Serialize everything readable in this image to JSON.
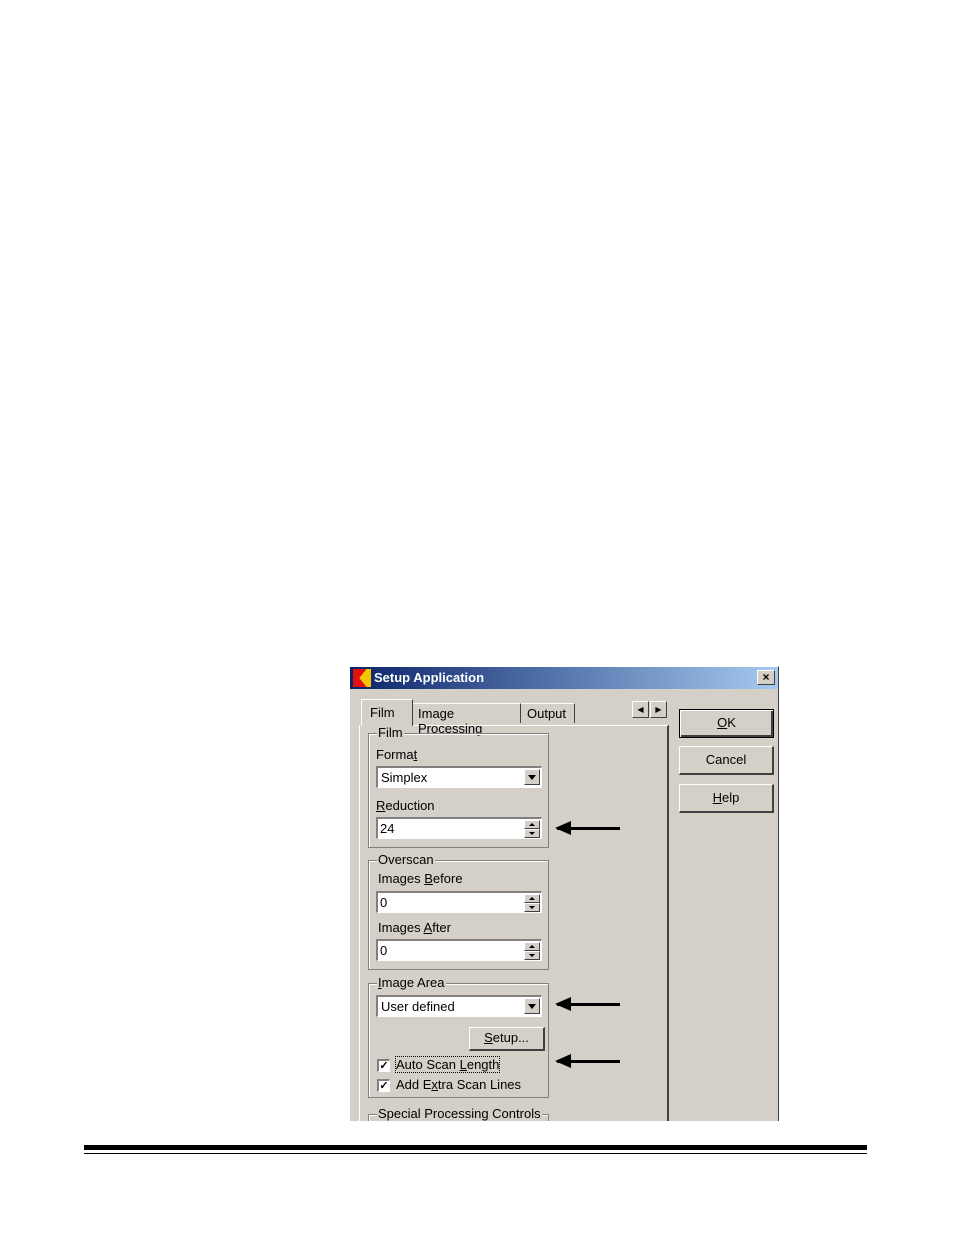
{
  "window": {
    "title": "Setup Application",
    "close_glyph": "×"
  },
  "tabs": [
    {
      "label": "Film",
      "selected": true
    },
    {
      "label": "Image Processing",
      "selected": false
    },
    {
      "label": "Output",
      "selected": false
    }
  ],
  "tab_scroll": {
    "left_glyph": "◀",
    "right_glyph": "▶"
  },
  "film_group": {
    "title": "Film",
    "format_label_pre": "Forma",
    "format_label_acc": "t",
    "format_value": "Simplex",
    "reduction_label_acc": "R",
    "reduction_label_post": "eduction",
    "reduction_value": "24"
  },
  "overscan_group": {
    "title": "Overscan",
    "before_label_pre": "Images ",
    "before_label_acc": "B",
    "before_label_post": "efore",
    "before_value": "0",
    "after_label_pre": "Images ",
    "after_label_acc": "A",
    "after_label_post": "fter",
    "after_value": "0"
  },
  "image_area_group": {
    "title_acc": "I",
    "title_post": "mage Area",
    "area_value": "User defined",
    "setup_button_acc": "S",
    "setup_button_post": "etup...",
    "auto_scan_pre": "Auto Scan ",
    "auto_scan_acc": "L",
    "auto_scan_post": "ength",
    "auto_scan_checked": "✓",
    "extra_scan_pre": "Add E",
    "extra_scan_acc": "x",
    "extra_scan_post": "tra Scan Lines",
    "extra_scan_checked": "✓"
  },
  "special_group": {
    "title": "Special Processing Controls"
  },
  "buttons": {
    "ok_acc": "O",
    "ok_post": "K",
    "cancel": "Cancel",
    "help_acc": "H",
    "help_post": "elp"
  },
  "colors": {
    "dialog_bg": "#d4d0c8",
    "title_gradient_start": "#0a246a",
    "title_gradient_end": "#a6caf0",
    "arrow": "#000000"
  }
}
